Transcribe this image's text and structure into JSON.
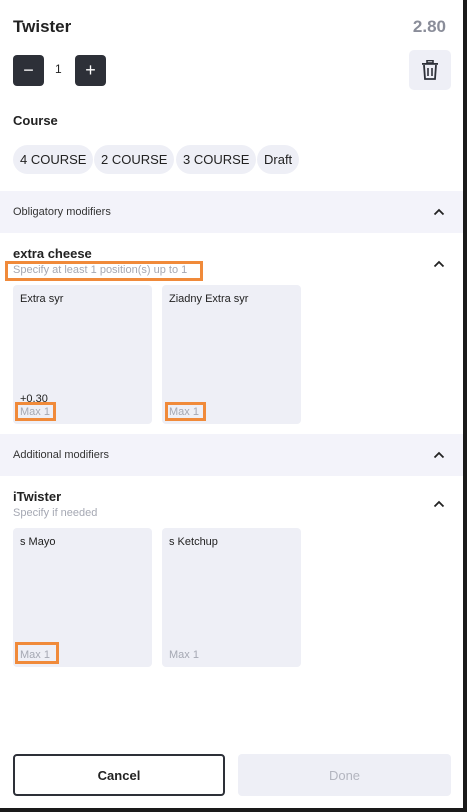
{
  "item": {
    "title": "Twister",
    "price": "2.80"
  },
  "quantity": {
    "minus": "−",
    "value": "1",
    "plus": "+"
  },
  "course": {
    "label": "Course",
    "options": [
      "4 COURSE",
      "2 COURSE",
      "3 COURSE",
      "Draft"
    ]
  },
  "obligatory": {
    "header": "Obligatory modifiers",
    "group": {
      "title": "extra cheese",
      "subtitle": "Specify at least 1 position(s)  up to 1",
      "items": [
        {
          "name": "Extra syr",
          "price": "+0.30",
          "max": "Max 1"
        },
        {
          "name": "Ziadny Extra syr",
          "price": "",
          "max": "Max 1"
        }
      ]
    }
  },
  "additional": {
    "header": "Additional modifiers",
    "group": {
      "title": "iTwister",
      "subtitle": "Specify if needed",
      "items": [
        {
          "name": "s Mayo",
          "max": "Max 1"
        },
        {
          "name": "s Ketchup",
          "max": "Max 1"
        }
      ]
    }
  },
  "actions": {
    "cancel": "Cancel",
    "done": "Done"
  },
  "icons": {
    "delete": "trash-icon",
    "collapse": "chevron-up-icon"
  },
  "colors": {
    "highlight": "#f08a3a",
    "dark_button": "#2d3038",
    "panel": "#eeeff6"
  }
}
